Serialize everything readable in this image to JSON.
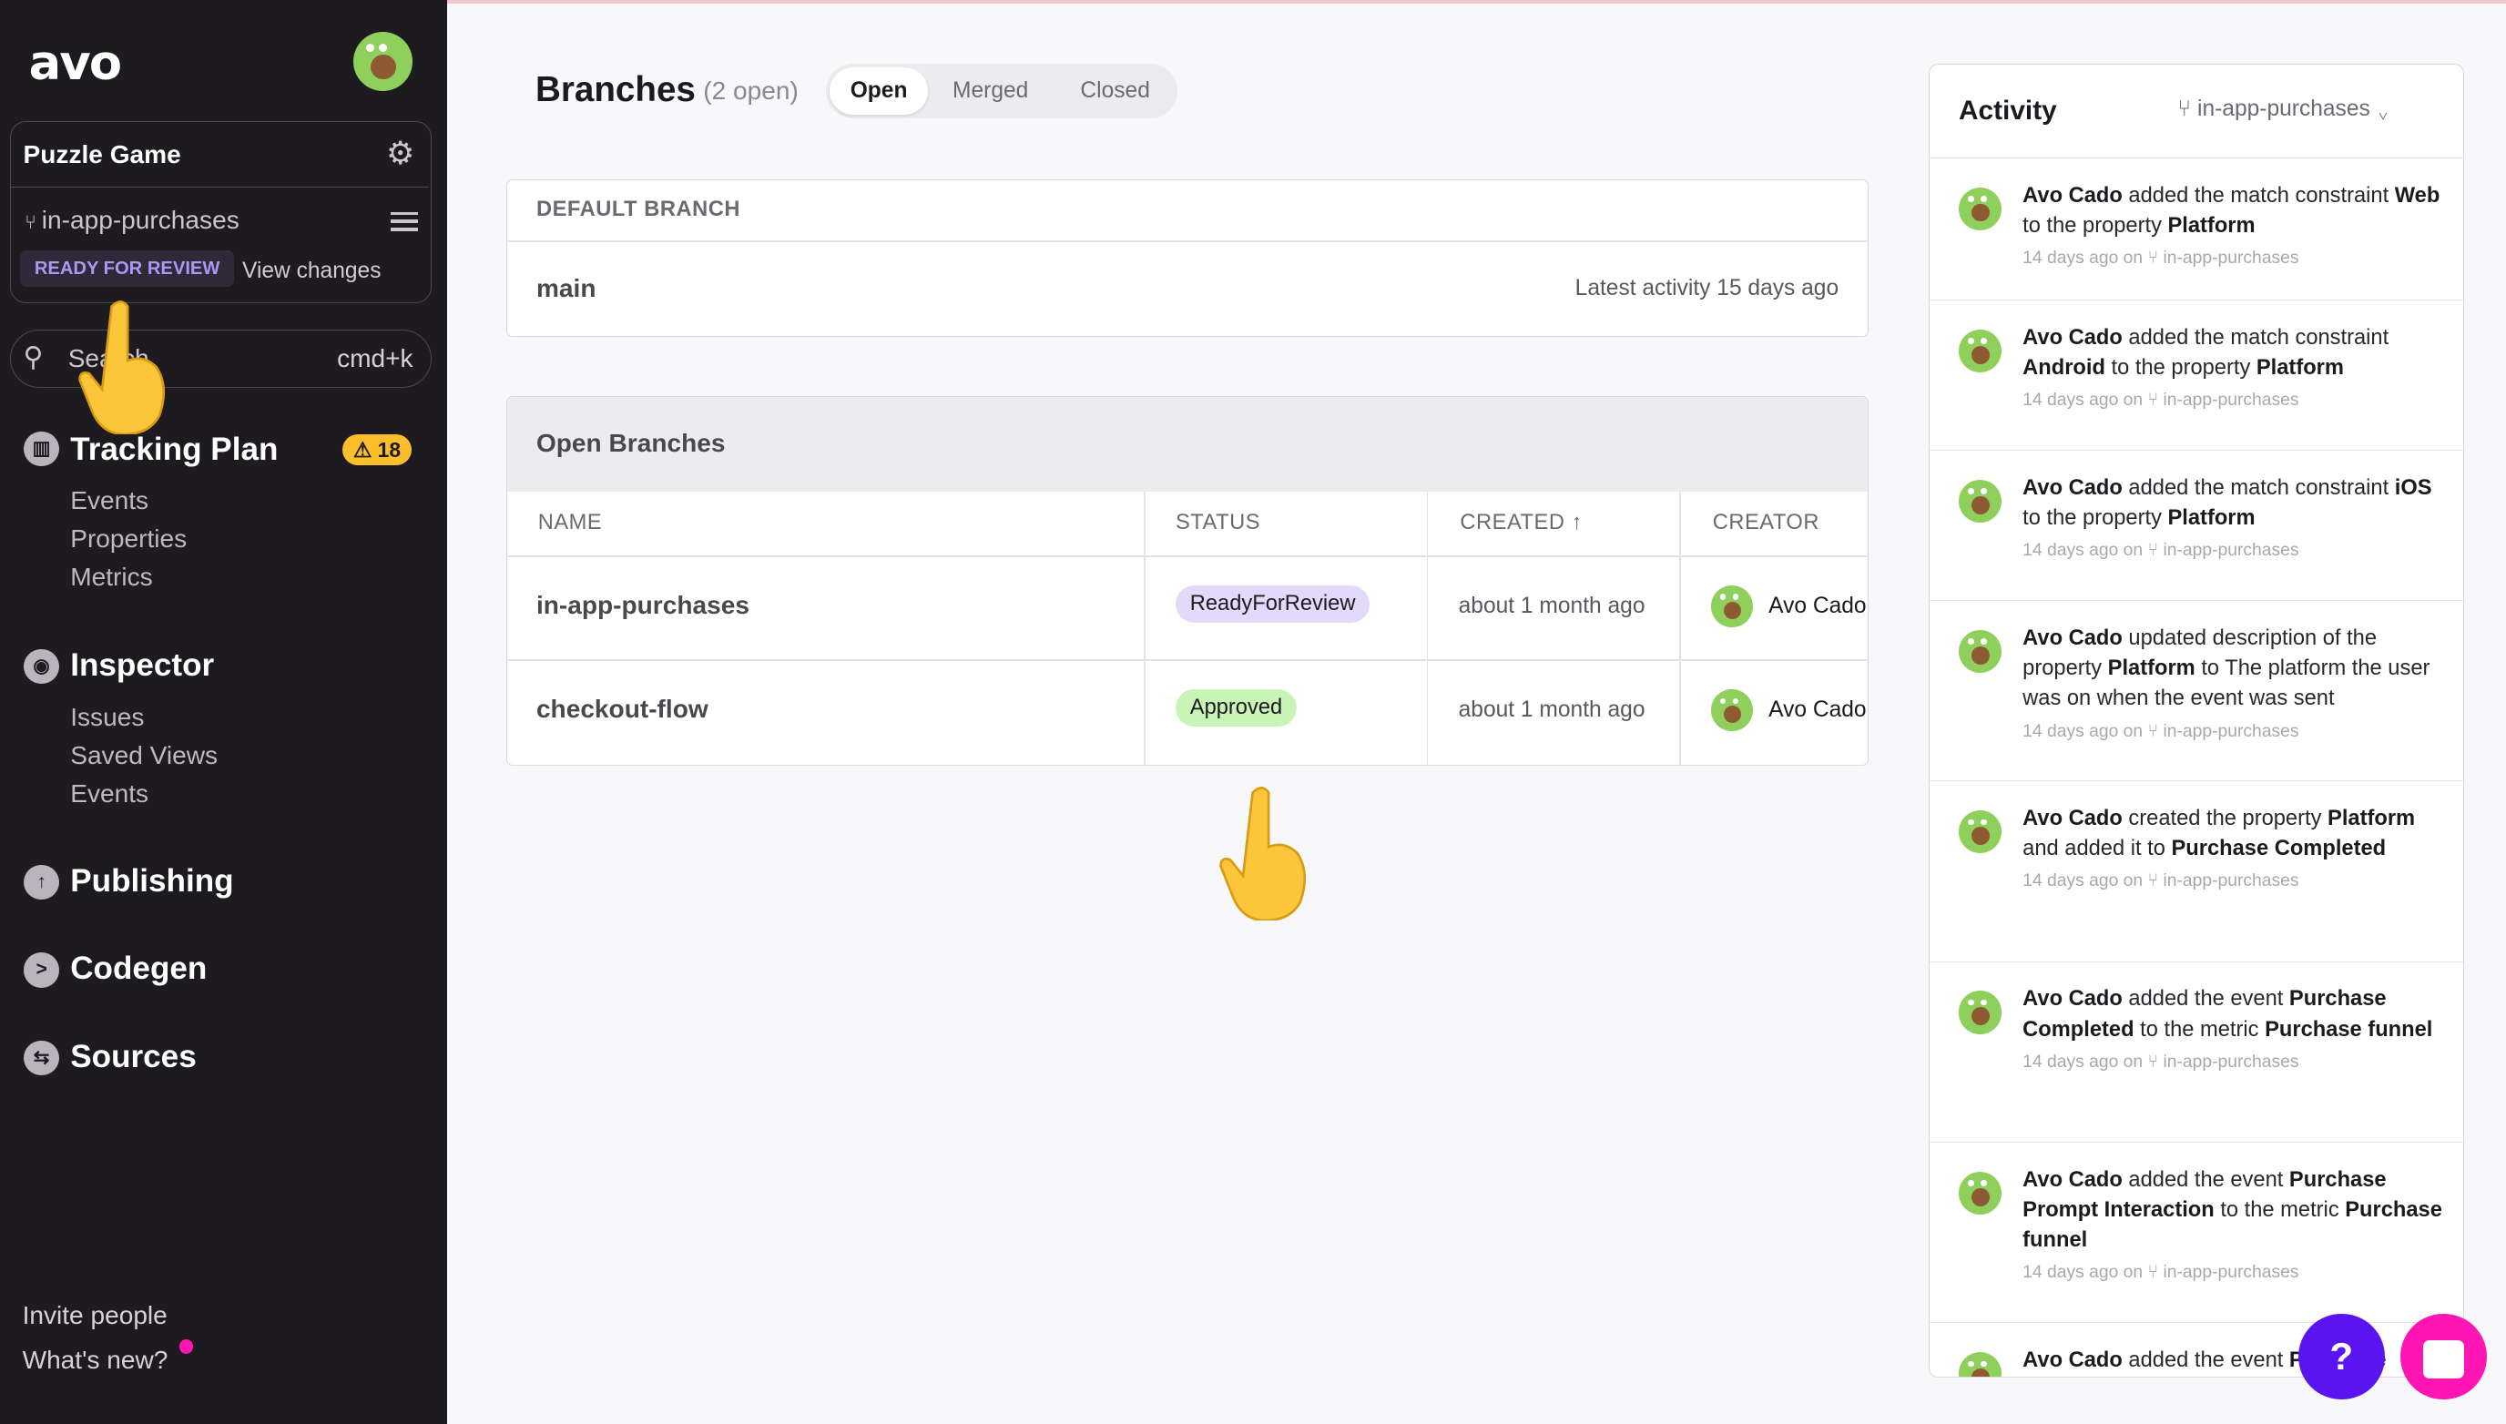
{
  "sidebar": {
    "logo": "avo",
    "workspace": {
      "name": "Puzzle Game",
      "branch": "in-app-purchases",
      "status": "READY FOR REVIEW",
      "view_changes": "View changes"
    },
    "search": {
      "placeholder": "Search",
      "shortcut": "cmd+k"
    },
    "tracking_plan": {
      "label": "Tracking Plan",
      "badge": "18",
      "items": [
        "Events",
        "Properties",
        "Metrics"
      ]
    },
    "inspector": {
      "label": "Inspector",
      "items": [
        "Issues",
        "Saved Views",
        "Events"
      ]
    },
    "publishing": "Publishing",
    "codegen": "Codegen",
    "sources": "Sources",
    "invite": "Invite people",
    "whats_new": "What's new?"
  },
  "main": {
    "title": "Branches",
    "count": "(2 open)",
    "tabs": [
      "Open",
      "Merged",
      "Closed"
    ],
    "default_branch": {
      "header": "DEFAULT BRANCH",
      "name": "main",
      "activity": "Latest activity 15 days ago"
    },
    "open_branches": {
      "header": "Open Branches",
      "columns": [
        "NAME",
        "STATUS",
        "CREATED",
        "CREATOR"
      ],
      "rows": [
        {
          "name": "in-app-purchases",
          "status": "ReadyForReview",
          "created": "about 1 month ago",
          "creator": "Avo Cado"
        },
        {
          "name": "checkout-flow",
          "status": "Approved",
          "created": "about 1 month ago",
          "creator": "Avo Cado"
        }
      ]
    }
  },
  "activity": {
    "title": "Activity",
    "branch": "in-app-purchases",
    "items": [
      {
        "segments": [
          {
            "t": "Avo Cado",
            "b": true
          },
          {
            "t": " added the match constraint "
          },
          {
            "t": "Web",
            "b": true
          },
          {
            "t": " to the property "
          },
          {
            "t": "Platform",
            "b": true
          }
        ],
        "meta": "14 days ago on ⑂ in-app-purchases"
      },
      {
        "segments": [
          {
            "t": "Avo Cado",
            "b": true
          },
          {
            "t": " added the match constraint "
          },
          {
            "t": "Android",
            "b": true
          },
          {
            "t": " to the property "
          },
          {
            "t": "Platform",
            "b": true
          }
        ],
        "meta": "14 days ago on ⑂ in-app-purchases"
      },
      {
        "segments": [
          {
            "t": "Avo Cado",
            "b": true
          },
          {
            "t": " added the match constraint "
          },
          {
            "t": "iOS",
            "b": true
          },
          {
            "t": " to the property "
          },
          {
            "t": "Platform",
            "b": true
          }
        ],
        "meta": "14 days ago on ⑂ in-app-purchases"
      },
      {
        "segments": [
          {
            "t": "Avo Cado",
            "b": true
          },
          {
            "t": " updated description of the property "
          },
          {
            "t": "Platform",
            "b": true
          },
          {
            "t": " to The platform the user was on when the event was sent"
          }
        ],
        "meta": "14 days ago on ⑂ in-app-purchases"
      },
      {
        "segments": [
          {
            "t": "Avo Cado",
            "b": true
          },
          {
            "t": " created the property "
          },
          {
            "t": "Platform",
            "b": true
          },
          {
            "t": " and added it to "
          },
          {
            "t": "Purchase Completed",
            "b": true
          }
        ],
        "meta": "14 days ago on ⑂ in-app-purchases"
      },
      {
        "segments": [
          {
            "t": "Avo Cado",
            "b": true
          },
          {
            "t": " added the event "
          },
          {
            "t": "Purchase Completed",
            "b": true
          },
          {
            "t": " to the metric "
          },
          {
            "t": "Purchase funnel",
            "b": true
          }
        ],
        "meta": "14 days ago on ⑂ in-app-purchases"
      },
      {
        "segments": [
          {
            "t": "Avo Cado",
            "b": true
          },
          {
            "t": " added the event "
          },
          {
            "t": "Purchase Prompt Interaction",
            "b": true
          },
          {
            "t": " to the metric "
          },
          {
            "t": "Purchase funnel",
            "b": true
          }
        ],
        "meta": "14 days ago on ⑂ in-app-purchases"
      },
      {
        "segments": [
          {
            "t": "Avo Cado",
            "b": true
          },
          {
            "t": " added the event "
          },
          {
            "t": "Purchase",
            "b": true
          }
        ],
        "meta": ""
      }
    ]
  },
  "colors": {
    "sidebar": "#1e1b20",
    "ready_for_review": "#e3d9fb",
    "approved": "#c8f5b5",
    "help": "#5a14f0",
    "chat": "#ff14b4",
    "warning": "#fbbf2c"
  },
  "icons": [
    "gear-icon",
    "branch-icon",
    "menu-icon",
    "search-icon",
    "map-icon",
    "inspector-icon",
    "cloud-upload-icon",
    "codegen-icon",
    "sources-icon",
    "warning-icon",
    "sort-up-icon",
    "chevron-down-icon",
    "help-icon",
    "chat-icon"
  ]
}
